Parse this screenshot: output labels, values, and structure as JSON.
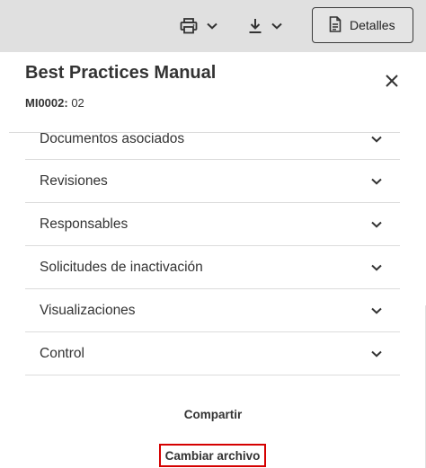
{
  "toolbar": {
    "print_icon": "printer-icon",
    "download_icon": "download-icon",
    "details_label": "Detalles",
    "details_icon": "document-icon"
  },
  "document": {
    "title": "Best Practices Manual",
    "code_label": "MI0002:",
    "code_value": "02"
  },
  "sections": [
    {
      "label": "Documentos asociados"
    },
    {
      "label": "Revisiones"
    },
    {
      "label": "Responsables"
    },
    {
      "label": "Solicitudes de inactivación"
    },
    {
      "label": "Visualizaciones"
    },
    {
      "label": "Control"
    }
  ],
  "actions": {
    "share_label": "Compartir",
    "change_file_label": "Cambiar archivo"
  },
  "colors": {
    "topbar": "#e0e0e0",
    "highlight": "#d50000",
    "divider": "#dcdcdc"
  }
}
